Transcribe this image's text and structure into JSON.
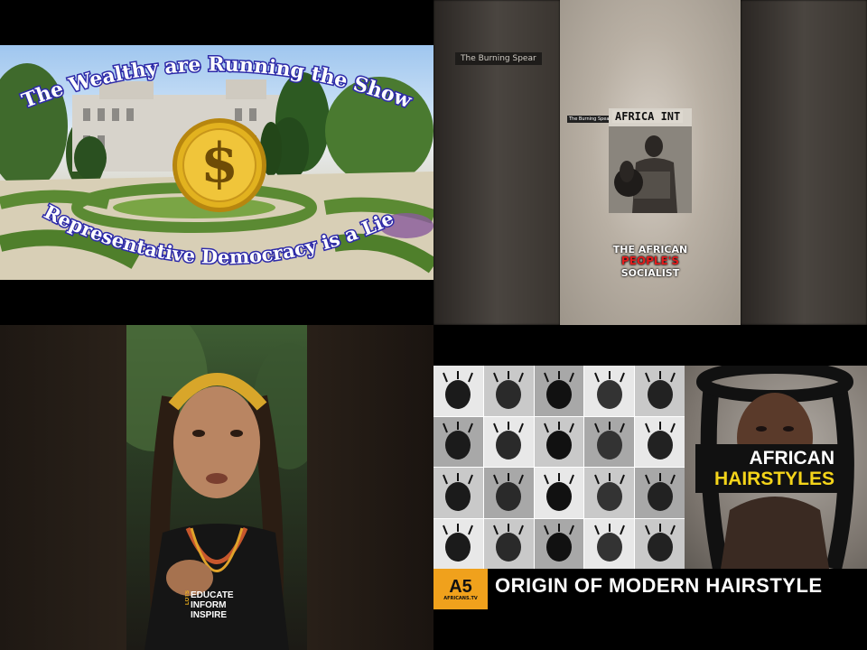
{
  "tile1": {
    "title_top": "The Wealthy are Running the Show",
    "title_bottom": "Representative Democracy is a Lie",
    "coin_symbol": "$",
    "accent_color": "#2d2aa8",
    "coin_color": "#e2b21f"
  },
  "tile2": {
    "channel_tag": "The Burning Spear",
    "small_tag": "The Burning Spear",
    "photo_label": "AFRICA  INT",
    "caption_line1": "THE AFRICAN",
    "caption_line2": "PEOPLE'S",
    "caption_line3": "SOCIALIST",
    "caption_accent_color": "#e11d1d"
  },
  "tile3": {
    "logo_side": "LOTS",
    "logo_line1": "EDUCATE",
    "logo_line2": "INFORM",
    "logo_line3": "INSPIRE"
  },
  "tile4": {
    "badge_line1": "AFRICAN",
    "badge_line2": "HAIRSTYLES",
    "bottom_title": "ORIGIN OF MODERN HAIRSTYLE",
    "logo_big": "A5",
    "logo_small": "AFRICANS.TV",
    "accent_color": "#f4d41a"
  }
}
